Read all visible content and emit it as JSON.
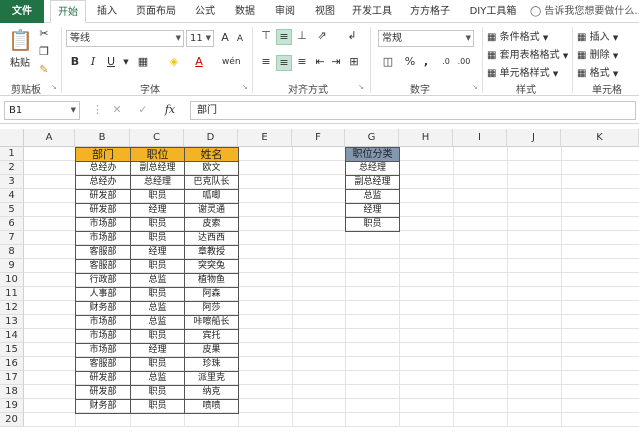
{
  "ribbon_tabs": [
    "文件",
    "开始",
    "插入",
    "页面布局",
    "公式",
    "数据",
    "审阅",
    "视图",
    "开发工具",
    "方方格子",
    "DIY工具箱"
  ],
  "tell_me": "告诉我您想要做什么...",
  "clipboard": {
    "paste": "粘贴",
    "label": "剪贴板"
  },
  "font": {
    "name": "等线",
    "size": "11",
    "label": "字体",
    "bold": "B",
    "italic": "I",
    "underline": "U",
    "grow": "A",
    "shrink": "A"
  },
  "alignment": {
    "label": "对齐方式"
  },
  "number": {
    "format": "常规",
    "label": "数字",
    "percent": "%",
    "comma": ","
  },
  "styles": {
    "conditional": "条件格式",
    "table": "套用表格格式",
    "cell": "单元格样式",
    "label": "样式"
  },
  "cells": {
    "insert": "插入",
    "delete": "删除",
    "format": "格式",
    "label": "单元格"
  },
  "formula_bar": {
    "name_box": "B1",
    "fx": "fx",
    "content": "部门"
  },
  "columns": [
    "A",
    "B",
    "C",
    "D",
    "E",
    "F",
    "G",
    "H",
    "I",
    "J",
    "K"
  ],
  "rows": [
    "1",
    "2",
    "3",
    "4",
    "5",
    "6",
    "7",
    "8",
    "9",
    "10",
    "11",
    "12",
    "13",
    "14",
    "15",
    "16",
    "17",
    "18",
    "19",
    "20"
  ],
  "table1": {
    "headers": [
      "部门",
      "职位",
      "姓名"
    ],
    "rows": [
      [
        "总经办",
        "副总经理",
        "欧文"
      ],
      [
        "总经办",
        "总经理",
        "巴克队长"
      ],
      [
        "研发部",
        "职员",
        "呱唧"
      ],
      [
        "研发部",
        "经理",
        "谢灵通"
      ],
      [
        "市场部",
        "职员",
        "皮索"
      ],
      [
        "市场部",
        "职员",
        "达西西"
      ],
      [
        "客服部",
        "经理",
        "章教授"
      ],
      [
        "客服部",
        "职员",
        "突突兔"
      ],
      [
        "行政部",
        "总监",
        "植物鱼"
      ],
      [
        "人事部",
        "职员",
        "阿森"
      ],
      [
        "财务部",
        "总监",
        "阿莎"
      ],
      [
        "市场部",
        "总监",
        "咔嚓船长"
      ],
      [
        "市场部",
        "职员",
        "宾托"
      ],
      [
        "市场部",
        "经理",
        "皮果"
      ],
      [
        "客服部",
        "职员",
        "珍珠"
      ],
      [
        "研发部",
        "总监",
        "派里克"
      ],
      [
        "研发部",
        "职员",
        "纳克"
      ],
      [
        "财务部",
        "职员",
        "喷喷"
      ]
    ]
  },
  "table2": {
    "header": "职位分类",
    "items": [
      "总经理",
      "副总经理",
      "总监",
      "经理",
      "职员"
    ]
  }
}
